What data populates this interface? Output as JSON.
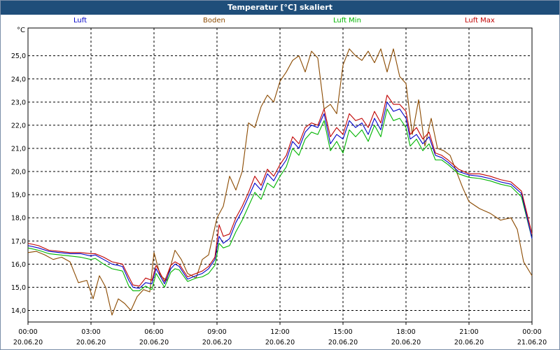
{
  "chart_data": {
    "type": "line",
    "title": "Temperatur [°C] skaliert",
    "ylabel": "°C",
    "ylim": [
      13.5,
      26.2
    ],
    "xlim": [
      0,
      24
    ],
    "grid": true,
    "y_ticks": [
      "14,0",
      "15,0",
      "16,0",
      "17,0",
      "18,0",
      "19,0",
      "20,0",
      "21,0",
      "22,0",
      "23,0",
      "24,0",
      "25,0"
    ],
    "x_ticks": [
      {
        "time": "00:00",
        "date": "20.06.20"
      },
      {
        "time": "03:00",
        "date": "20.06.20"
      },
      {
        "time": "06:00",
        "date": "20.06.20"
      },
      {
        "time": "09:00",
        "date": "20.06.20"
      },
      {
        "time": "12:00",
        "date": "20.06.20"
      },
      {
        "time": "15:00",
        "date": "20.06.20"
      },
      {
        "time": "18:00",
        "date": "20.06.20"
      },
      {
        "time": "21:00",
        "date": "20.06.20"
      },
      {
        "time": "00:00",
        "date": "21.06.20"
      }
    ],
    "series": [
      {
        "name": "Luft",
        "color": "#0000c8",
        "x": [
          0,
          0.5,
          1,
          1.5,
          2,
          2.5,
          3,
          3.2,
          3.6,
          4,
          4.5,
          4.8,
          5,
          5.3,
          5.6,
          5.9,
          6.1,
          6.5,
          6.8,
          7,
          7.2,
          7.6,
          8,
          8.3,
          8.6,
          8.9,
          9.1,
          9.3,
          9.6,
          9.9,
          10.2,
          10.5,
          10.8,
          11.1,
          11.4,
          11.7,
          12,
          12.3,
          12.6,
          12.9,
          13.2,
          13.5,
          13.8,
          14.1,
          14.4,
          14.7,
          15,
          15.3,
          15.6,
          15.9,
          16.2,
          16.5,
          16.8,
          17.1,
          17.4,
          17.7,
          18,
          18.2,
          18.5,
          18.8,
          19.1,
          19.4,
          19.7,
          20,
          20.5,
          21,
          21.5,
          22,
          22.5,
          23,
          23.5,
          24
        ],
        "y": [
          16.8,
          16.7,
          16.55,
          16.5,
          16.45,
          16.45,
          16.35,
          16.4,
          16.2,
          16.0,
          15.9,
          15.3,
          15.0,
          14.95,
          15.2,
          15.15,
          15.8,
          15.15,
          15.8,
          16.0,
          15.9,
          15.35,
          15.5,
          15.6,
          15.8,
          16.2,
          17.2,
          16.9,
          17.1,
          17.8,
          18.3,
          18.9,
          19.5,
          19.2,
          19.9,
          19.6,
          20.1,
          20.5,
          21.3,
          21.0,
          21.7,
          22.0,
          21.9,
          22.5,
          21.2,
          21.6,
          21.4,
          22.2,
          21.9,
          22.1,
          21.6,
          22.3,
          21.8,
          23.0,
          22.6,
          22.7,
          22.3,
          21.4,
          21.6,
          21.2,
          21.5,
          20.7,
          20.6,
          20.4,
          20.0,
          19.85,
          19.8,
          19.7,
          19.55,
          19.45,
          19.05,
          17.1
        ]
      },
      {
        "name": "Boden",
        "color": "#8b4a00",
        "x": [
          0,
          0.4,
          0.8,
          1.2,
          1.6,
          2,
          2.4,
          2.8,
          3.1,
          3.4,
          3.7,
          4,
          4.3,
          4.6,
          4.9,
          5.2,
          5.5,
          5.8,
          6,
          6.3,
          6.6,
          7,
          7.3,
          7.6,
          8,
          8.3,
          8.6,
          9,
          9.3,
          9.6,
          9.9,
          10.2,
          10.5,
          10.8,
          11.1,
          11.4,
          11.7,
          12,
          12.3,
          12.6,
          12.9,
          13.2,
          13.5,
          13.8,
          14.1,
          14.4,
          14.7,
          15,
          15.3,
          15.6,
          15.9,
          16.2,
          16.5,
          16.8,
          17.1,
          17.4,
          17.7,
          18,
          18.3,
          18.6,
          18.9,
          19.2,
          19.5,
          19.8,
          20.1,
          20.4,
          20.7,
          21,
          21.5,
          22,
          22.5,
          23,
          23.3,
          23.6,
          24
        ],
        "y": [
          16.5,
          16.55,
          16.4,
          16.2,
          16.3,
          16.1,
          15.2,
          15.3,
          14.5,
          15.5,
          15.0,
          13.8,
          14.5,
          14.3,
          14.0,
          14.6,
          14.9,
          14.8,
          16.5,
          15.5,
          15.3,
          16.6,
          16.2,
          15.6,
          15.4,
          16.2,
          16.4,
          18.0,
          18.5,
          19.8,
          19.2,
          20.0,
          22.1,
          21.9,
          22.8,
          23.3,
          23.0,
          23.9,
          24.3,
          24.8,
          25.0,
          24.3,
          25.2,
          24.9,
          22.7,
          22.9,
          22.5,
          24.6,
          25.3,
          25.0,
          24.8,
          25.2,
          24.7,
          25.3,
          24.3,
          25.3,
          24.1,
          23.8,
          21.6,
          23.1,
          21.1,
          22.3,
          21.0,
          20.9,
          20.7,
          20.0,
          19.3,
          18.7,
          18.4,
          18.2,
          17.9,
          18.0,
          17.5,
          16.1,
          15.5
        ]
      },
      {
        "name": "Luft Min",
        "color": "#00b400",
        "x": [
          0,
          0.5,
          1,
          1.5,
          2,
          2.5,
          3,
          3.2,
          3.6,
          4,
          4.5,
          4.8,
          5,
          5.3,
          5.6,
          5.9,
          6.1,
          6.5,
          6.8,
          7,
          7.2,
          7.6,
          8,
          8.3,
          8.6,
          8.9,
          9.1,
          9.3,
          9.6,
          9.9,
          10.2,
          10.5,
          10.8,
          11.1,
          11.4,
          11.7,
          12,
          12.3,
          12.6,
          12.9,
          13.2,
          13.5,
          13.8,
          14.1,
          14.4,
          14.7,
          15,
          15.3,
          15.6,
          15.9,
          16.2,
          16.5,
          16.8,
          17.1,
          17.4,
          17.7,
          18,
          18.2,
          18.5,
          18.8,
          19.1,
          19.4,
          19.7,
          20,
          20.5,
          21,
          21.5,
          22,
          22.5,
          23,
          23.5,
          24
        ],
        "y": [
          16.7,
          16.6,
          16.45,
          16.4,
          16.35,
          16.3,
          16.2,
          16.25,
          16.0,
          15.8,
          15.7,
          15.05,
          14.85,
          14.85,
          15.05,
          14.9,
          15.6,
          15.0,
          15.65,
          15.8,
          15.75,
          15.25,
          15.4,
          15.45,
          15.6,
          15.95,
          16.9,
          16.7,
          16.8,
          17.4,
          17.9,
          18.5,
          19.1,
          18.8,
          19.5,
          19.3,
          19.8,
          20.2,
          21.0,
          20.7,
          21.4,
          21.7,
          21.6,
          22.2,
          20.9,
          21.3,
          20.8,
          21.8,
          21.5,
          21.8,
          21.3,
          22.0,
          21.5,
          22.7,
          22.2,
          22.3,
          21.9,
          21.1,
          21.4,
          20.9,
          21.2,
          20.5,
          20.5,
          20.3,
          19.9,
          19.75,
          19.7,
          19.6,
          19.45,
          19.35,
          18.9,
          17.1
        ]
      },
      {
        "name": "Luft Max",
        "color": "#c00000",
        "x": [
          0,
          0.5,
          1,
          1.5,
          2,
          2.5,
          3,
          3.2,
          3.6,
          4,
          4.5,
          4.8,
          5,
          5.3,
          5.6,
          5.9,
          6.1,
          6.5,
          6.8,
          7,
          7.2,
          7.6,
          8,
          8.3,
          8.6,
          8.9,
          9.1,
          9.3,
          9.6,
          9.9,
          10.2,
          10.5,
          10.8,
          11.1,
          11.4,
          11.7,
          12,
          12.3,
          12.6,
          12.9,
          13.2,
          13.5,
          13.8,
          14.1,
          14.4,
          14.7,
          15,
          15.3,
          15.6,
          15.9,
          16.2,
          16.5,
          16.8,
          17.1,
          17.4,
          17.7,
          18,
          18.2,
          18.5,
          18.8,
          19.1,
          19.4,
          19.7,
          20,
          20.5,
          21,
          21.5,
          22,
          22.5,
          23,
          23.5,
          24
        ],
        "y": [
          16.9,
          16.8,
          16.6,
          16.55,
          16.5,
          16.5,
          16.45,
          16.45,
          16.3,
          16.1,
          16.0,
          15.45,
          15.1,
          15.05,
          15.4,
          15.3,
          15.95,
          15.25,
          15.95,
          16.1,
          16.0,
          15.45,
          15.6,
          15.7,
          15.9,
          16.3,
          17.7,
          17.2,
          17.3,
          18.0,
          18.5,
          19.1,
          19.8,
          19.4,
          20.1,
          19.8,
          20.3,
          20.7,
          21.5,
          21.2,
          21.9,
          22.1,
          22.0,
          22.7,
          21.5,
          21.9,
          21.6,
          22.5,
          22.2,
          22.3,
          21.9,
          22.6,
          22.1,
          23.3,
          22.9,
          22.9,
          22.6,
          21.6,
          21.9,
          21.4,
          21.7,
          20.8,
          20.7,
          20.5,
          20.1,
          19.9,
          19.9,
          19.8,
          19.65,
          19.55,
          19.15,
          17.3
        ]
      }
    ]
  }
}
